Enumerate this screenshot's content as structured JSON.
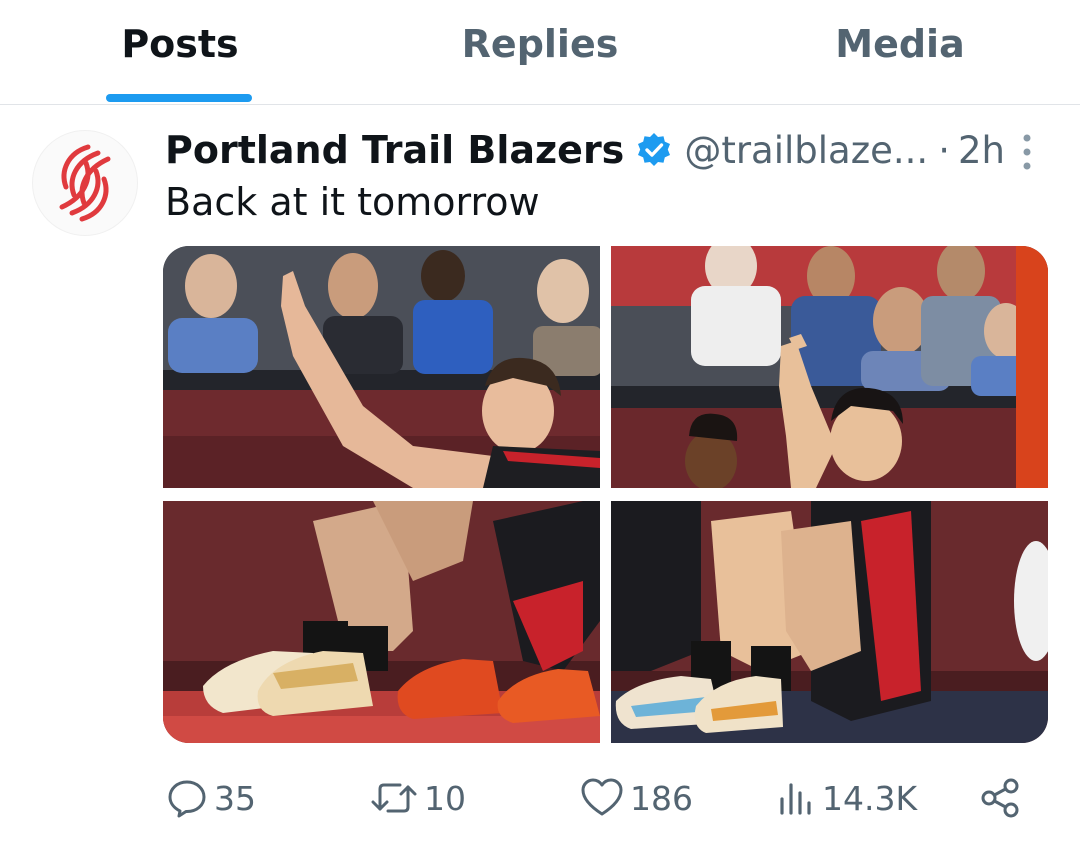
{
  "tabs": [
    {
      "label": "Posts",
      "active": true
    },
    {
      "label": "Replies",
      "active": false
    },
    {
      "label": "Media",
      "active": false
    }
  ],
  "tweet": {
    "author_name": "Portland Trail Blazers",
    "verified": true,
    "handle": "@trailblaze...",
    "separator": "·",
    "time": "2h",
    "text": "Back at it tomorrow",
    "media_count": 4
  },
  "actions": {
    "replies": "35",
    "reposts": "10",
    "likes": "186",
    "views": "14.3K"
  },
  "icons": {
    "avatar": "trail-blazers-logo",
    "verified": "verified-badge-icon",
    "more": "more-vertical-icon",
    "reply": "reply-icon",
    "repost": "repost-icon",
    "like": "heart-icon",
    "views": "views-icon",
    "share": "share-icon"
  },
  "colors": {
    "accent": "#1d9bf0",
    "text_primary": "#0f1419",
    "text_secondary": "#536471",
    "brand_red": "#e03a3e"
  }
}
